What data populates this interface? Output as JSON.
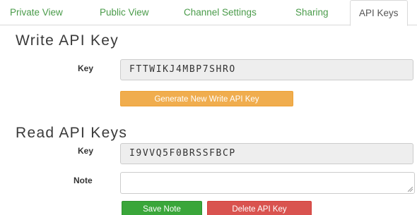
{
  "tabs": [
    {
      "label": "Private View"
    },
    {
      "label": "Public View"
    },
    {
      "label": "Channel Settings"
    },
    {
      "label": "Sharing"
    },
    {
      "label": "API Keys",
      "active": true
    }
  ],
  "write_section": {
    "heading": "Write API Key",
    "key_label": "Key",
    "key_value": "FTTWIKJ4MBP7SHRO",
    "generate_button": "Generate New Write API Key"
  },
  "read_section": {
    "heading": "Read API Keys",
    "key_label": "Key",
    "key_value": "I9VVQ5F0BRSSFBCP",
    "note_label": "Note",
    "note_value": "",
    "save_button": "Save Note",
    "delete_button": "Delete API Key"
  },
  "colors": {
    "tab_link": "#4a9b4a",
    "warning": "#f0ad4e",
    "success": "#3aa63a",
    "danger": "#d9534f"
  }
}
